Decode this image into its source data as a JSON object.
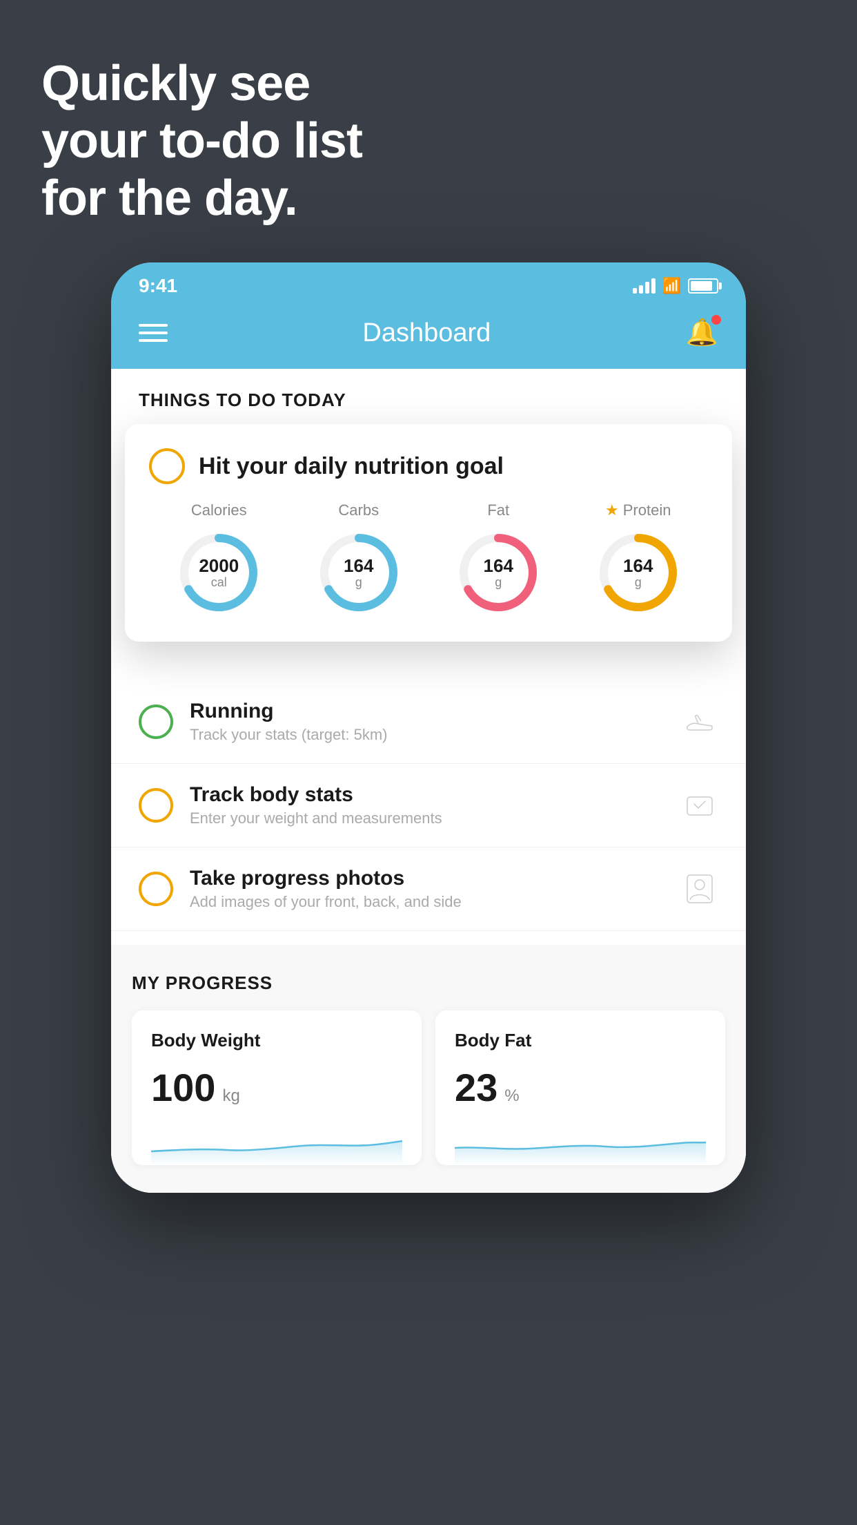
{
  "background": {
    "color": "#3a3f47"
  },
  "hero": {
    "line1": "Quickly see",
    "line2": "your to-do list",
    "line3": "for the day."
  },
  "status_bar": {
    "time": "9:41"
  },
  "nav": {
    "title": "Dashboard"
  },
  "things_header": "THINGS TO DO TODAY",
  "nutrition_card": {
    "title": "Hit your daily nutrition goal",
    "stats": [
      {
        "label": "Calories",
        "value": "2000",
        "unit": "cal",
        "color": "blue",
        "starred": false
      },
      {
        "label": "Carbs",
        "value": "164",
        "unit": "g",
        "color": "blue",
        "starred": false
      },
      {
        "label": "Fat",
        "value": "164",
        "unit": "g",
        "color": "pink",
        "starred": false
      },
      {
        "label": "Protein",
        "value": "164",
        "unit": "g",
        "color": "yellow",
        "starred": true
      }
    ]
  },
  "todo_items": [
    {
      "circle_color": "green",
      "title": "Running",
      "subtitle": "Track your stats (target: 5km)",
      "icon": "shoe"
    },
    {
      "circle_color": "yellow",
      "title": "Track body stats",
      "subtitle": "Enter your weight and measurements",
      "icon": "scale"
    },
    {
      "circle_color": "yellow",
      "title": "Take progress photos",
      "subtitle": "Add images of your front, back, and side",
      "icon": "person"
    }
  ],
  "progress": {
    "section_title": "MY PROGRESS",
    "cards": [
      {
        "title": "Body Weight",
        "value": "100",
        "unit": "kg"
      },
      {
        "title": "Body Fat",
        "value": "23",
        "unit": "%"
      }
    ]
  }
}
